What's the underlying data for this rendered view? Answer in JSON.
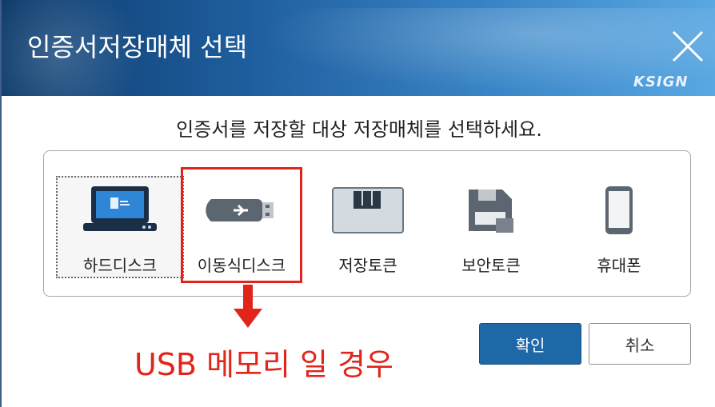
{
  "dialog": {
    "title": "인증서저장매체 선택",
    "brand": "KSIGN",
    "instruction": "인증서를 저장할 대상 저장매체를 선택하세요."
  },
  "media": {
    "items": [
      {
        "label": "하드디스크",
        "icon": "laptop-icon"
      },
      {
        "label": "이동식디스크",
        "icon": "usb-drive-icon"
      },
      {
        "label": "저장토큰",
        "icon": "storage-token-icon"
      },
      {
        "label": "보안토큰",
        "icon": "security-token-icon"
      },
      {
        "label": "휴대폰",
        "icon": "phone-icon"
      }
    ],
    "selected": "하드디스크"
  },
  "annotation": {
    "text": "USB 메모리 일 경우",
    "color": "#e1251b"
  },
  "buttons": {
    "ok": "확인",
    "cancel": "취소"
  },
  "colors": {
    "titlebar": "#1f5f9f",
    "primary_button": "#1f68a8"
  }
}
